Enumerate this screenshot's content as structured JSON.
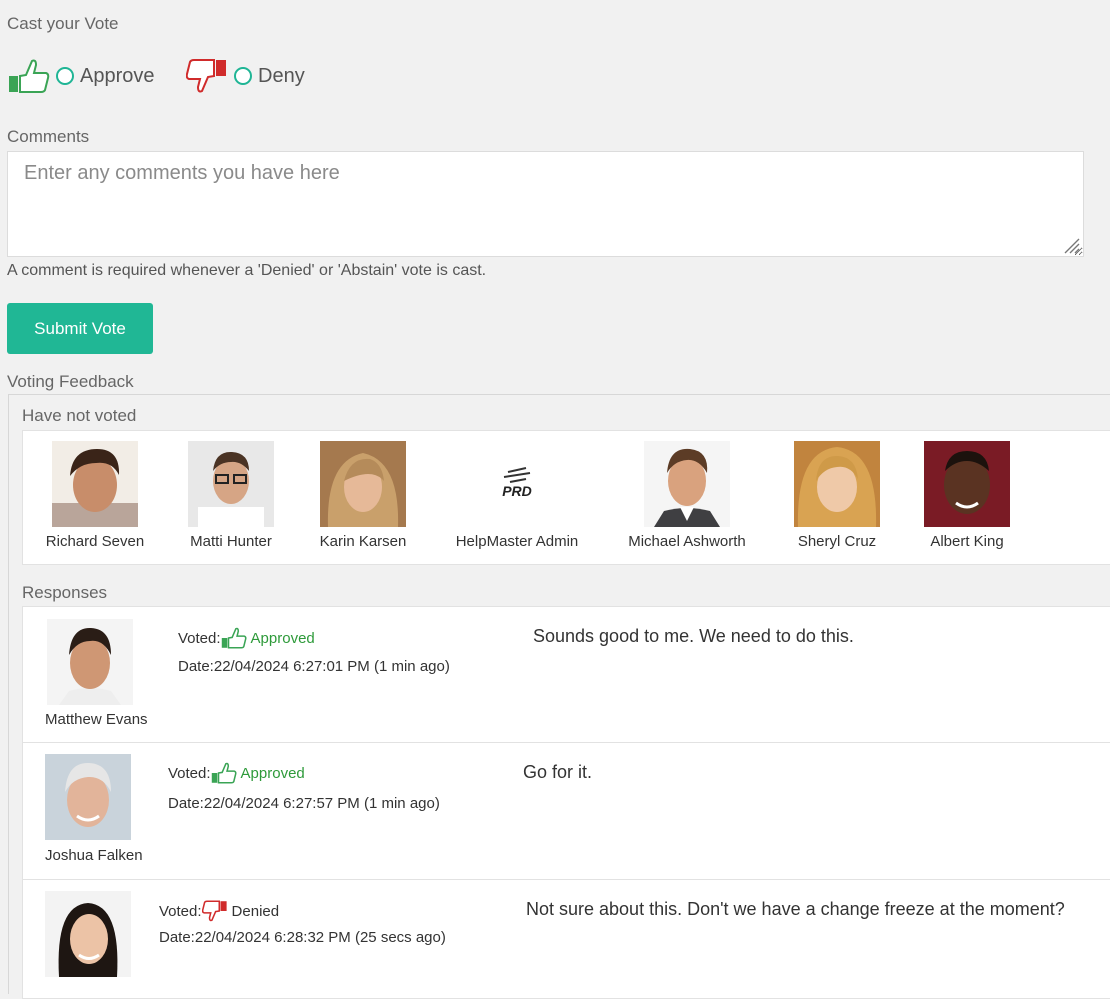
{
  "vote": {
    "heading": "Cast your Vote",
    "approve_label": "Approve",
    "deny_label": "Deny"
  },
  "comments": {
    "label": "Comments",
    "placeholder": "Enter any comments you have here",
    "hint": "A comment is required whenever a 'Denied' or 'Abstain' vote is cast."
  },
  "submit_label": "Submit Vote",
  "feedback": {
    "heading": "Voting Feedback",
    "not_voted_heading": "Have not voted",
    "not_voted": [
      {
        "name": "Richard Seven"
      },
      {
        "name": "Matti Hunter"
      },
      {
        "name": "Karin Karsen"
      },
      {
        "name": "HelpMaster Admin",
        "logo_text": "PRD"
      },
      {
        "name": "Michael Ashworth"
      },
      {
        "name": "Sheryl Cruz"
      },
      {
        "name": "Albert King"
      }
    ],
    "responses_heading": "Responses",
    "responses": [
      {
        "name": "Matthew Evans",
        "voted_label": "Voted:",
        "status": "Approved",
        "date": "Date:22/04/2024 6:27:01 PM (1 min ago)",
        "comment": "Sounds good to me.  We need to do this."
      },
      {
        "name": "Joshua Falken",
        "voted_label": "Voted:",
        "status": "Approved",
        "date": "Date:22/04/2024 6:27:57 PM (1 min ago)",
        "comment": "Go for it."
      },
      {
        "name": "",
        "voted_label": "Voted:",
        "status": "Denied",
        "date": "Date:22/04/2024 6:28:32 PM (25 secs ago)",
        "comment": "Not sure about this.  Don't we have a change freeze at the moment?"
      }
    ]
  },
  "colors": {
    "accent": "#20b795",
    "approve_green": "#2e9a3a",
    "deny_red": "#d02b2b"
  }
}
